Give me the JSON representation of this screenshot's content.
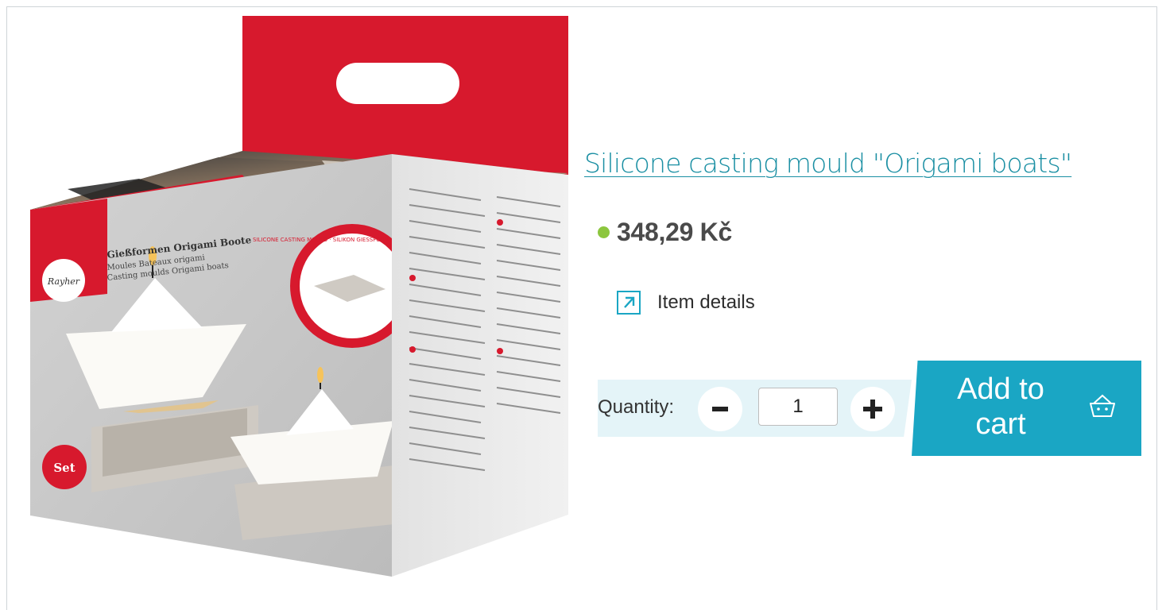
{
  "product": {
    "title": "Silicone casting mould \"Origami boats\"",
    "price": "348,29 Kč",
    "stock_color": "#8cc63e",
    "details_link_label": "Item details",
    "details_icon": "external-link-icon"
  },
  "packaging": {
    "brand": "Rayher",
    "title_de": "Gießformen Origami Boote",
    "title_fr": "Moules Bateaux origami",
    "title_en": "Casting moulds Origami boats",
    "badge": "Set",
    "seal_text": "SILICONE CASTING MOULD · SILIKON GIESSFORM · MOULE EN SILICONE"
  },
  "quantity": {
    "label": "Quantity:",
    "value": "1",
    "minus_icon": "minus-icon",
    "plus_icon": "plus-icon"
  },
  "cart": {
    "label": "Add to cart",
    "icon": "basket-icon"
  },
  "colors": {
    "accent": "#1aa6c4",
    "title": "#1a8fa3",
    "quantity_bg": "#e4f4f8",
    "package_red": "#d7192d"
  }
}
